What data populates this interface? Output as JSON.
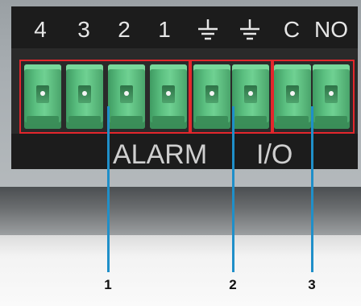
{
  "pin_labels": [
    "4",
    "3",
    "2",
    "1",
    "C",
    "NO"
  ],
  "icons": [
    "ground-icon",
    "ground-icon"
  ],
  "group_labels": [
    "ALARM",
    "I/O"
  ],
  "callouts": [
    "1",
    "2",
    "3"
  ],
  "colors": {
    "terminal_green": "#5bbf80",
    "highlight_red": "#e3262c",
    "callout_blue": "#1f8fc9",
    "label_strip": "#1c1c1c"
  }
}
